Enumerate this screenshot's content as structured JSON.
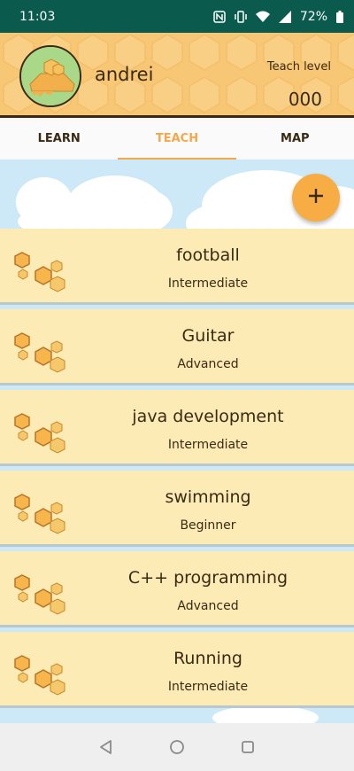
{
  "status_bar": {
    "time": "11:03",
    "battery": "72%",
    "icons": [
      "nfc-icon",
      "vibrate-icon",
      "wifi-icon",
      "signal-icon",
      "battery-icon"
    ]
  },
  "profile": {
    "username": "andrei",
    "teach_level_label": "Teach level",
    "teach_level_value": "000"
  },
  "tabs": [
    {
      "label": "LEARN",
      "active": false
    },
    {
      "label": "TEACH",
      "active": true
    },
    {
      "label": "MAP",
      "active": false
    }
  ],
  "fab": {
    "icon": "plus-icon"
  },
  "skills": [
    {
      "name": "football",
      "level": "Intermediate"
    },
    {
      "name": "Guitar",
      "level": "Advanced"
    },
    {
      "name": "java development",
      "level": "Intermediate"
    },
    {
      "name": "swimming",
      "level": "Beginner"
    },
    {
      "name": "C++ programming",
      "level": "Advanced"
    },
    {
      "name": "Running",
      "level": "Intermediate"
    }
  ],
  "nav_bar": {
    "icons": [
      "back-icon",
      "home-icon",
      "recents-icon"
    ]
  },
  "colors": {
    "status_bar": "#0a5a4e",
    "header": "#f7c776",
    "accent": "#f3a84b",
    "fab": "#f7ad43",
    "card": "#fdebb6",
    "sky": "#cde8f6"
  }
}
